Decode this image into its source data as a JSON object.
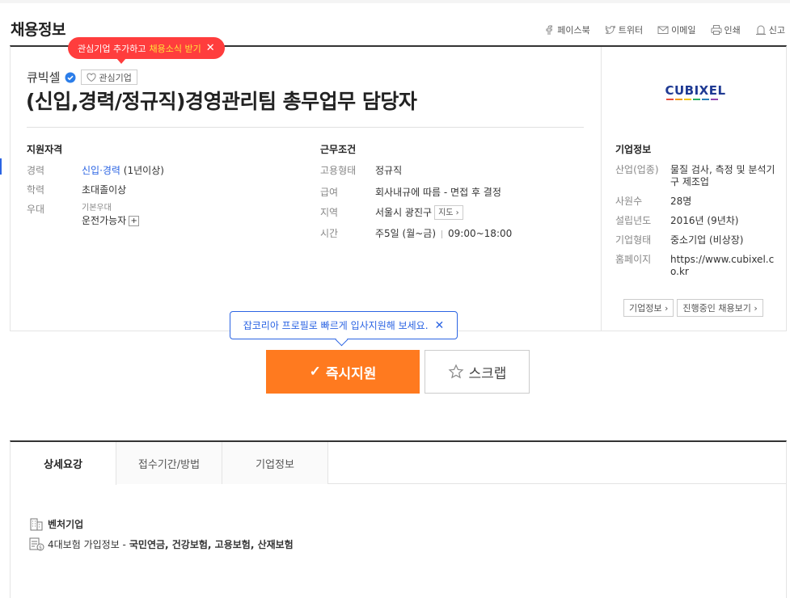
{
  "header": {
    "title": "채용정보",
    "share": [
      {
        "icon": "facebook-icon",
        "label": "페이스북"
      },
      {
        "icon": "twitter-icon",
        "label": "트위터"
      },
      {
        "icon": "email-icon",
        "label": "이메일"
      },
      {
        "icon": "print-icon",
        "label": "인쇄"
      },
      {
        "icon": "report-icon",
        "label": "신고"
      }
    ]
  },
  "tooltip": {
    "text": "관심기업 추가하고 ",
    "highlight": "채용소식 받기"
  },
  "job": {
    "company": "큐빅셀",
    "favorite_label": "관심기업",
    "title": "(신입,경력/정규직)경영관리팀 총무업무 담당자"
  },
  "qualifications": {
    "heading": "지원자격",
    "career_label": "경력",
    "career_value": "신입·경력",
    "career_detail": " (1년이상)",
    "education_label": "학력",
    "education_value": "초대졸이상",
    "preference_label": "우대",
    "preference_sub": "기본우대",
    "preference_value": "운전가능자"
  },
  "conditions": {
    "heading": "근무조건",
    "type_label": "고용형태",
    "type_value": "정규직",
    "salary_label": "급여",
    "salary_value": "회사내규에 따름 - 면접 후 결정",
    "location_label": "지역",
    "location_value": "서울시 광진구",
    "map_label": "지도",
    "time_label": "시간",
    "time_days": "주5일 (월~금)",
    "time_hours": "09:00~18:00"
  },
  "company_info": {
    "logo_text": "CUBIXEL",
    "heading": "기업정보",
    "rows": [
      {
        "label": "산업(업종)",
        "value": "물질 검사, 측정 및 분석기구 제조업"
      },
      {
        "label": "사원수",
        "value": "28명"
      },
      {
        "label": "설립년도",
        "value": "2016년 (9년차)"
      },
      {
        "label": "기업형태",
        "value": "중소기업 (비상장)"
      },
      {
        "label": "홈페이지",
        "value": "https://www.cubixel.co.kr"
      }
    ],
    "link_company": "기업정보",
    "link_jobs": "진행중인 채용보기"
  },
  "apply": {
    "tip": "잡코리아 프로필로 빠르게 입사지원해 보세요.",
    "apply_label": "즉시지원",
    "scrap_label": "스크랩"
  },
  "tabs": [
    "상세요강",
    "접수기간/방법",
    "기업정보"
  ],
  "benefits": {
    "venture": "벤처기업",
    "insurance_label": "4대보험 가입정보 - ",
    "insurance_value": "국민연금, 건강보험, 고용보험, 산재보험"
  },
  "colors": {
    "accent_orange": "#ff7a1f",
    "accent_blue": "#2b64e3",
    "tooltip_red": "#ff3d3d"
  }
}
